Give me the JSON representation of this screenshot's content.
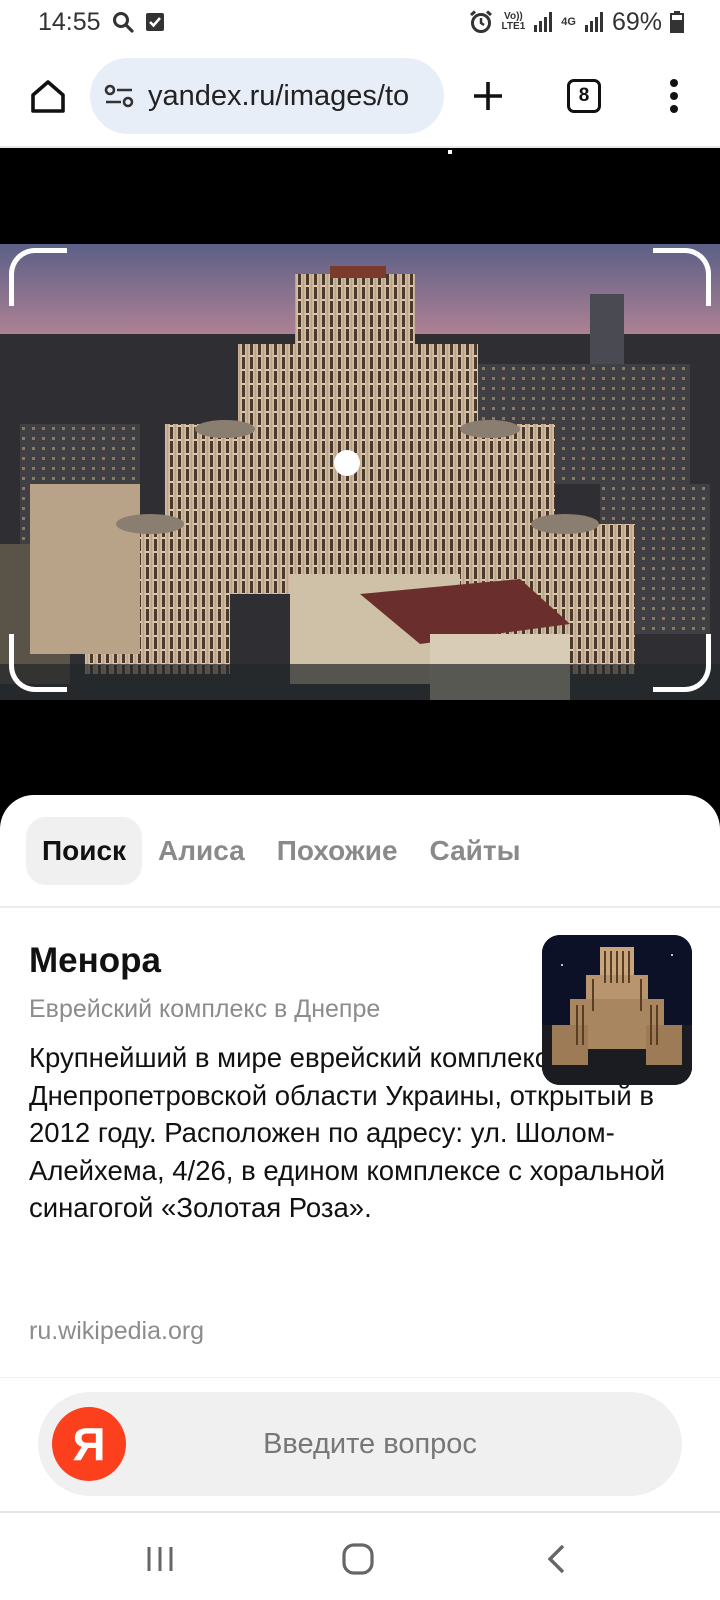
{
  "status_bar": {
    "time": "14:55",
    "battery": "69%",
    "icons": [
      "search-icon",
      "checkbox-notification-icon",
      "alarm-icon",
      "volte-icon",
      "signal-icon",
      "4g-icon",
      "signal-icon",
      "battery-icon"
    ],
    "volte_label_top": "Vo))",
    "volte_label_bottom": "LTE1",
    "net_label": "4G"
  },
  "browser": {
    "url": "yandex.ru/images/to",
    "tab_count": "8",
    "icons": [
      "home-icon",
      "site-settings-icon",
      "new-tab-plus-icon",
      "tab-switcher-icon",
      "more-vert-icon"
    ]
  },
  "sheet": {
    "tabs": [
      {
        "label": "Поиск",
        "active": true
      },
      {
        "label": "Алиса",
        "active": false
      },
      {
        "label": "Похожие",
        "active": false
      },
      {
        "label": "Сайты",
        "active": false
      }
    ],
    "result": {
      "title": "Менора",
      "subtitle": "Еврейский комплекс в Днепре",
      "description": "Крупнейший в мире еврейский комплекс в Днепре Днепропетровской области Украины, открытый в 2012 году. Расположен по адресу: ул. Шолом-Алейхема, 4/26, в едином комплексе с хоральной синагогой «Золотая Роза».",
      "source": "ru.wikipedia.org"
    }
  },
  "search": {
    "logo_letter": "Я",
    "placeholder": "Введите вопрос"
  },
  "colors": {
    "yandex_red": "#fc3f1d",
    "url_pill": "#e8eef8"
  }
}
